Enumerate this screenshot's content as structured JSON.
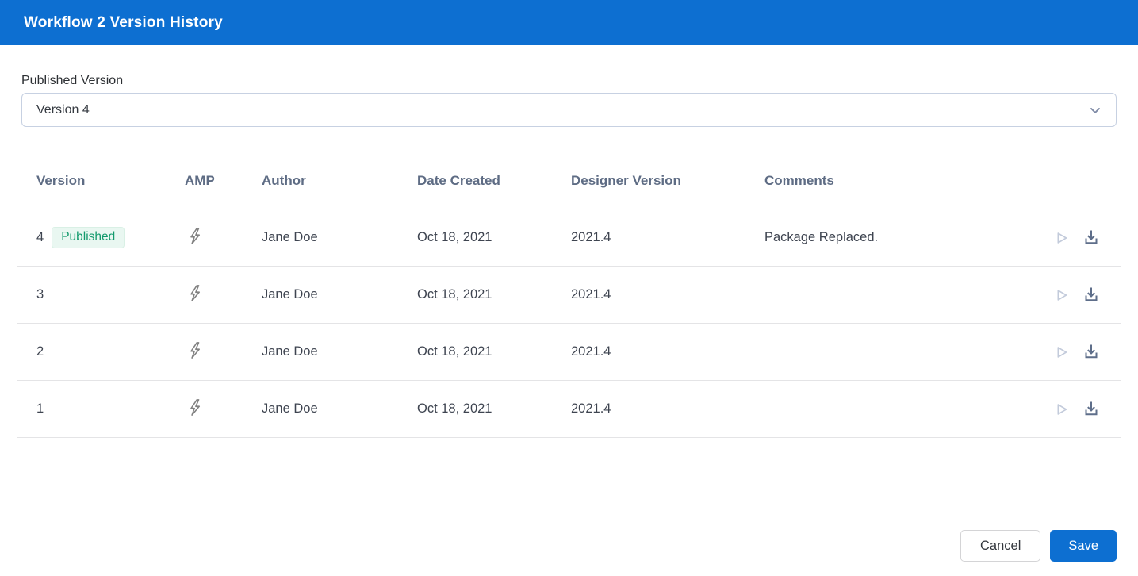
{
  "dialog": {
    "title": "Workflow 2 Version History"
  },
  "published_version": {
    "label": "Published Version",
    "selected_value": "Version 4"
  },
  "table": {
    "columns": {
      "version": "Version",
      "amp": "AMP",
      "author": "Author",
      "date_created": "Date Created",
      "designer_version": "Designer Version",
      "comments": "Comments"
    },
    "rows": [
      {
        "version": "4",
        "badge": "Published",
        "amp": true,
        "author": "Jane Doe",
        "date_created": "Oct 18, 2021",
        "designer_version": "2021.4",
        "comments": "Package Replaced."
      },
      {
        "version": "3",
        "badge": "",
        "amp": true,
        "author": "Jane Doe",
        "date_created": "Oct 18, 2021",
        "designer_version": "2021.4",
        "comments": ""
      },
      {
        "version": "2",
        "badge": "",
        "amp": true,
        "author": "Jane Doe",
        "date_created": "Oct 18, 2021",
        "designer_version": "2021.4",
        "comments": ""
      },
      {
        "version": "1",
        "badge": "",
        "amp": true,
        "author": "Jane Doe",
        "date_created": "Oct 18, 2021",
        "designer_version": "2021.4",
        "comments": ""
      }
    ]
  },
  "footer": {
    "cancel_label": "Cancel",
    "save_label": "Save"
  },
  "icons": {
    "amp": "lightning-icon",
    "run": "play-icon",
    "download": "download-icon",
    "select": "chevron-down-icon"
  },
  "colors": {
    "primary_blue": "#0d6fd1",
    "header_text": "#5e6c84",
    "badge_green": "#129a6c",
    "badge_bg": "#e9f7f1",
    "icon_muted": "#c3cbdb",
    "icon_dark": "#5e6e8a",
    "bolt_gray": "#808080"
  }
}
